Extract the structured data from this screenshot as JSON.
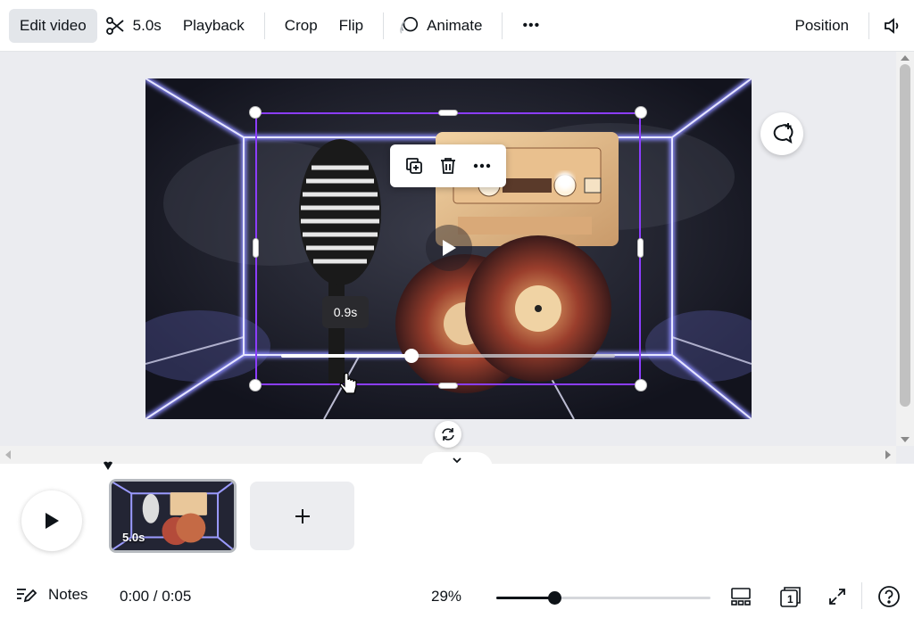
{
  "toolbar": {
    "edit_video": "Edit video",
    "split_icon": "scissors-icon",
    "duration": "5.0s",
    "playback": "Playback",
    "crop": "Crop",
    "flip": "Flip",
    "animate": "Animate",
    "more": "•••",
    "position": "Position",
    "volume_icon": "speaker-icon"
  },
  "canvas": {
    "tooltip_time": "0.9s",
    "scrub_progress": 0.39,
    "float_menu": [
      "duplicate-icon",
      "trash-icon",
      "more-icon"
    ]
  },
  "timeline": {
    "clip_duration": "5.0s",
    "add_label": "+"
  },
  "footer": {
    "notes": "Notes",
    "time": "0:00 / 0:05",
    "zoom": "29%",
    "zoom_level": 0.27,
    "page_count": "1"
  },
  "colors": {
    "selection": "#8b3dff",
    "neon": "#7b7bff",
    "active_tab_bg": "#e3e6ea"
  }
}
